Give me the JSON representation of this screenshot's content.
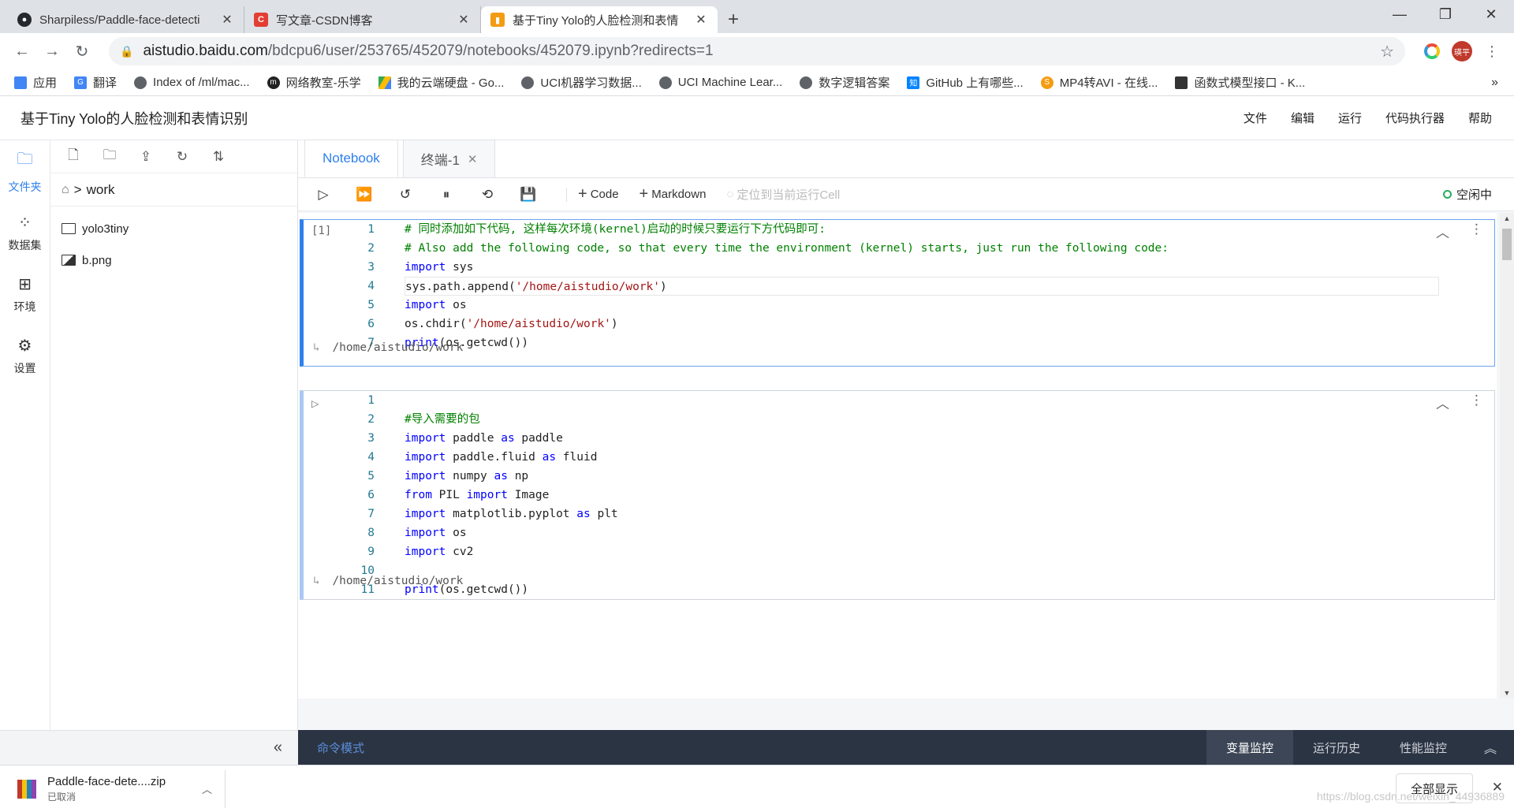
{
  "browser": {
    "tabs": [
      {
        "title": "Sharpiless/Paddle-face-detecti",
        "favicon": "github-icon",
        "color": "#24292e"
      },
      {
        "title": "写文章-CSDN博客",
        "favicon": "csdn-icon",
        "color": "#e33e33"
      },
      {
        "title": "基于Tiny Yolo的人脸检测和表情",
        "favicon": "aistudio-icon",
        "color": "#f39c12"
      }
    ],
    "url_host": "aistudio.baidu.com",
    "url_path": "/bdcpu6/user/253765/452079/notebooks/452079.ipynb?redirects=1",
    "avatar_text": "瑛平",
    "bookmarks": [
      "应用",
      "翻译",
      "Index of /ml/mac...",
      "网络教室-乐学",
      "我的云端硬盘 - Go...",
      "UCI机器学习数据...",
      "UCI Machine Lear...",
      "数字逻辑答案",
      "GitHub 上有哪些...",
      "MP4转AVI - 在线...",
      "函数式模型接口 - K..."
    ],
    "bookmarks_more": "»"
  },
  "app": {
    "title": "基于Tiny Yolo的人脸检测和表情识别",
    "menu": [
      "文件",
      "编辑",
      "运行",
      "代码执行器",
      "帮助"
    ]
  },
  "rail": [
    {
      "label": "文件夹",
      "icon": "folder-icon"
    },
    {
      "label": "数据集",
      "icon": "dataset-icon"
    },
    {
      "label": "环境",
      "icon": "environment-icon"
    },
    {
      "label": "设置",
      "icon": "settings-icon"
    }
  ],
  "files": {
    "breadcrumb": "work",
    "items": [
      {
        "name": "yolo3tiny",
        "type": "folder"
      },
      {
        "name": "b.png",
        "type": "image"
      }
    ]
  },
  "notebook": {
    "tabs": [
      "Notebook",
      "终端-1"
    ],
    "toolbar": {
      "code": "Code",
      "markdown": "Markdown",
      "locate": "定位到当前运行Cell",
      "status": "空闲中"
    },
    "cells": [
      {
        "prompt": "[1]",
        "lines": [
          "1",
          "2",
          "3",
          "4",
          "5",
          "6",
          "7"
        ],
        "output": "/home/aistudio/work"
      },
      {
        "prompt": "▷",
        "lines": [
          "1",
          "2",
          "3",
          "4",
          "5",
          "6",
          "7",
          "8",
          "9",
          "10",
          "11"
        ],
        "output": "/home/aistudio/work"
      }
    ]
  },
  "statusbar": {
    "mode": "命令模式",
    "tabs": [
      "变量监控",
      "运行历史",
      "性能监控"
    ]
  },
  "download": {
    "file": "Paddle-face-dete....zip",
    "status": "已取消",
    "show_all": "全部显示"
  },
  "watermark": "https://blog.csdn.net/weixin_44936889"
}
